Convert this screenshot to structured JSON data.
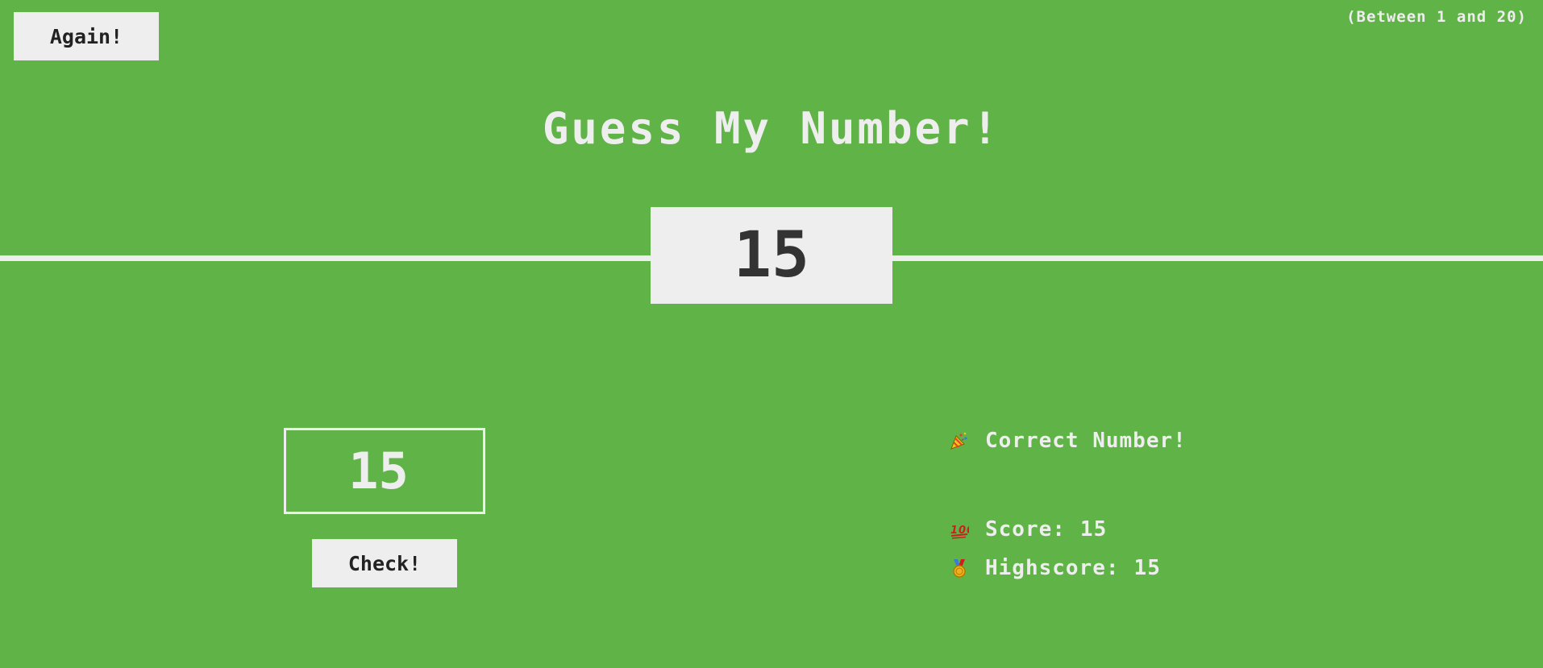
{
  "header": {
    "again_label": "Again!",
    "range_note": "(Between 1 and 20)"
  },
  "title": "Guess My Number!",
  "secret_number": "15",
  "guess": {
    "value": "15"
  },
  "check_label": "Check!",
  "message": {
    "icon": "party-popper-icon",
    "text": "Correct Number!"
  },
  "score": {
    "icon": "hundred-points-icon",
    "label": "Score:",
    "value": "15"
  },
  "highscore": {
    "icon": "medal-icon",
    "label": "Highscore:",
    "value": "15"
  },
  "colors": {
    "background": "#60b347",
    "foreground": "#eeeeee",
    "button_text": "#222222",
    "number_text": "#333333"
  }
}
